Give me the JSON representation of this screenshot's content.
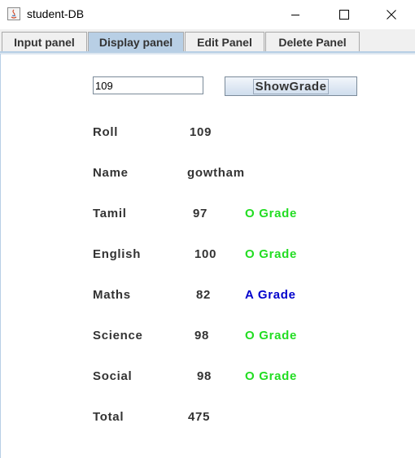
{
  "window": {
    "title": "student-DB",
    "minimize_glyph": "—",
    "maximize_glyph": "☐",
    "close_glyph": "✕"
  },
  "tabs": [
    {
      "label": "Input panel",
      "selected": false
    },
    {
      "label": "Display panel",
      "selected": true
    },
    {
      "label": "Edit Panel",
      "selected": false
    },
    {
      "label": "Delete Panel",
      "selected": false
    }
  ],
  "search": {
    "value": "109",
    "button_label": "ShowGrade"
  },
  "student": {
    "roll_label": "Roll",
    "roll_value": "109",
    "name_label": "Name",
    "name_value": "gowtham",
    "total_label": "Total",
    "total_value": "475"
  },
  "subjects": [
    {
      "label": "Tamil",
      "mark": "97",
      "grade": "O Grade"
    },
    {
      "label": "English",
      "mark": "100",
      "grade": "O Grade"
    },
    {
      "label": "Maths",
      "mark": "82",
      "grade": "A Grade"
    },
    {
      "label": "Science",
      "mark": "98",
      "grade": "O Grade"
    },
    {
      "label": "Social",
      "mark": "98",
      "grade": "O Grade"
    }
  ],
  "colors": {
    "grade_o": "#22dd22",
    "grade_a": "#0000cc",
    "tab_selected": "#b8cfe5"
  }
}
